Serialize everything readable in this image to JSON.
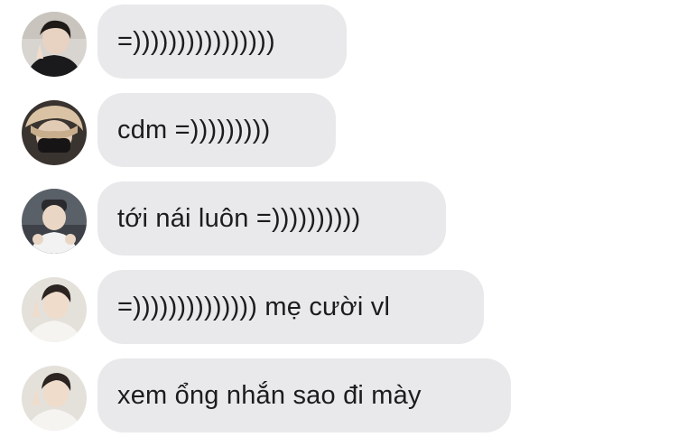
{
  "messages": [
    {
      "text": "=))))))))))))))))",
      "avatar": "user-avatar-1"
    },
    {
      "text": "cdm =)))))))))",
      "avatar": "user-avatar-2"
    },
    {
      "text": "tới nái luôn =))))))))))",
      "avatar": "user-avatar-3"
    },
    {
      "text": "=)))))))))))))) mẹ cười vl",
      "avatar": "user-avatar-4"
    },
    {
      "text": "xem ổng nhắn sao đi mày",
      "avatar": "user-avatar-5"
    }
  ],
  "colors": {
    "bubble_bg": "#e9e9eb",
    "text": "#1c1c1e",
    "background": "#ffffff"
  }
}
